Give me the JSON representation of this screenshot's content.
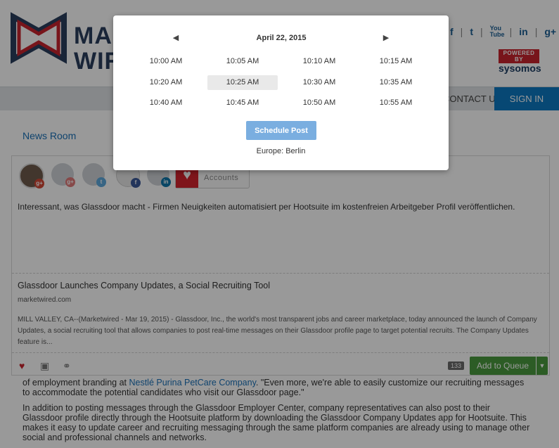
{
  "site": {
    "logo_text_line1": "MARKET",
    "logo_text_line2": "WIRED",
    "social": [
      "f",
      "t",
      "You Tube",
      "in",
      "g+"
    ],
    "powered_by": "POWERED BY",
    "sysomos": "sysomos",
    "nav_contact": "CONTACT US",
    "nav_signin": "SIGN IN",
    "news_room": "News Room"
  },
  "article": {
    "p1_prefix": "of employment branding at ",
    "p1_link": "Nestlé Purina PetCare Company",
    "p1_suffix": ". \"Even more, we're able to easily customize our recruiting messages to accommodate the potential candidates who visit our Glassdoor page.\"",
    "p2": "In addition to posting messages through the Glassdoor Employer Center, company representatives can also post to their Glassdoor profile directly through the Hootsuite platform by downloading the Glassdoor Company Updates app for Hootsuite. This makes it easy to update career and recruiting messaging through the same platform companies are already using to manage other social and professional channels and networks."
  },
  "composer": {
    "add_accounts_label": "Accounts",
    "message": "Interessant, was Glassdoor macht - Firmen Neuigkeiten automatisiert per Hootsuite im kostenfreien Arbeitgeber Profil veröffentlichen.",
    "preview_title": "Glassdoor Launches Company Updates, a Social Recruiting Tool",
    "preview_domain": "marketwired.com",
    "preview_desc": "MILL VALLEY, CA--(Marketwired - Mar 19, 2015) - Glassdoor, Inc., the world's most transparent jobs and career marketplace, today announced the launch of Company Updates, a social recruiting tool that allows companies to post real-time messages on their Glassdoor profile page to target potential recruits. The Company Updates feature is...",
    "char_count": "133",
    "add_to_queue": "Add to Queue"
  },
  "picker": {
    "date_title": "April 22, 2015",
    "prev_icon": "chevron-left-icon",
    "next_icon": "chevron-right-icon",
    "times": [
      [
        "10:00 AM",
        "10:05 AM",
        "10:10 AM",
        "10:15 AM"
      ],
      [
        "10:20 AM",
        "10:25 AM",
        "10:30 AM",
        "10:35 AM"
      ],
      [
        "10:40 AM",
        "10:45 AM",
        "10:50 AM",
        "10:55 AM"
      ]
    ],
    "selected_time": "10:25 AM",
    "schedule_button": "Schedule Post",
    "timezone": "Europe: Berlin"
  },
  "colors": {
    "overlay": "#000000",
    "schedule_button": "#7aaee0",
    "add_to_queue": "#4a9a3e",
    "nav_signin": "#0d78c2"
  }
}
